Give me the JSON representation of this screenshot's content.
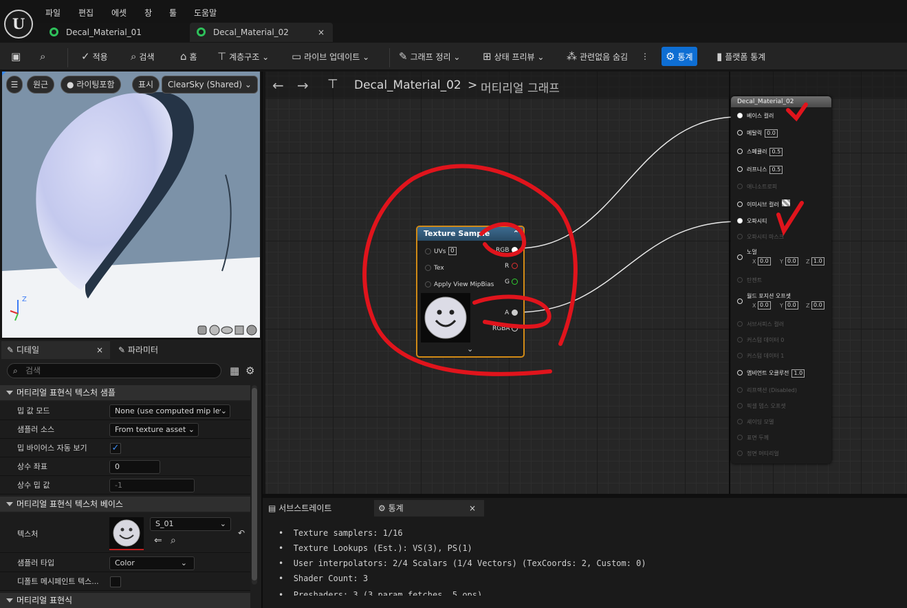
{
  "menu": {
    "file": "파일",
    "edit": "편집",
    "asset": "에셋",
    "window": "창",
    "tools": "툴",
    "help": "도움말"
  },
  "tabs": [
    {
      "label": "Decal_Material_01"
    },
    {
      "label": "Decal_Material_02",
      "close": "×"
    }
  ],
  "toolbar": {
    "apply": "적용",
    "search": "검색",
    "home": "홈",
    "hierarchy": "계층구조",
    "live_update": "라이브 업데이트",
    "clean_graph": "그래프 정리",
    "state_preview": "상태 프리뷰",
    "hide_unrelated": "관련없음 숨김",
    "stats": "통계",
    "platform_stats": "플랫폼 통계"
  },
  "viewport": {
    "perspective": "원근",
    "lighting": "라이팅포함",
    "show": "표시",
    "sky": "ClearSky (Shared)",
    "axis_z": "Z"
  },
  "details": {
    "tab_details": "디테일",
    "tab_params": "파라미터",
    "tab_close": "×",
    "search_placeholder": "검색",
    "section_sample": "머티리얼 표현식 텍스처 샘플",
    "mip_mode_label": "밉 값 모드",
    "mip_mode_value": "None (use computed mip lev",
    "sampler_source_label": "샘플러 소스",
    "sampler_source_value": "From texture asset",
    "mip_bias_label": "밉 바이어스 자동 보기",
    "mip_bias_check": "✓",
    "const_coord_label": "상수 좌표",
    "const_coord_value": "0",
    "const_mip_label": "상수 밉 값",
    "const_mip_value": "-1",
    "section_base": "머티리얼 표현식 텍스처 베이스",
    "texture_label": "텍스처",
    "texture_value": "S_01",
    "sampler_type_label": "샘플러 타입",
    "sampler_type_value": "Color",
    "default_mesh_label": "디폴트 메시페인트 텍스...",
    "section_expr": "머티리얼 표현식"
  },
  "graph": {
    "asset": "Decal_Material_02",
    "separator": ">",
    "graph_name": "머티리얼 그래프"
  },
  "texture_node": {
    "title": "Texture Sample",
    "uvs": "UVs",
    "uvs_value": "0",
    "tex": "Tex",
    "apply_mip": "Apply View MipBias",
    "rgb": "RGB",
    "r": "R",
    "g": "G",
    "a": "A",
    "rgba": "RGBA"
  },
  "result_node": {
    "title": "Decal_Material_02",
    "pins": [
      {
        "label": "베이스 컬러",
        "active": true,
        "connected": true
      },
      {
        "label": "메탈릭",
        "active": true,
        "value": "0.0"
      },
      {
        "label": "스페큘러",
        "active": true,
        "value": "0.5"
      },
      {
        "label": "러프니스",
        "active": true,
        "value": "0.5"
      },
      {
        "label": "애니소트로피",
        "active": false
      },
      {
        "label": "이미시브 컬러",
        "active": true
      },
      {
        "label": "오파시티",
        "active": true,
        "connected": true
      },
      {
        "label": "오파시티 마스크",
        "active": false
      },
      {
        "label": "노멀",
        "active": true,
        "x": "0.0",
        "y": "0.0",
        "z": "1.0"
      },
      {
        "label": "탄젠트",
        "active": false
      },
      {
        "label": "월드 포지션 오프셋",
        "active": true,
        "x": "0.0",
        "y": "0.0",
        "z": "0.0"
      },
      {
        "label": "서브서피스 컬러",
        "active": false
      },
      {
        "label": "커스텀 데이터 0",
        "active": false
      },
      {
        "label": "커스텀 데이터 1",
        "active": false
      },
      {
        "label": "앰비언트 오클루전",
        "active": true,
        "value": "1.0"
      },
      {
        "label": "리프랙션 (Disabled)",
        "active": false
      },
      {
        "label": "픽셀 뎁스 오프셋",
        "active": false
      },
      {
        "label": "셰이딩 모델",
        "active": false
      },
      {
        "label": "표면 두께",
        "active": false
      },
      {
        "label": "정면 머티리얼",
        "active": false
      }
    ]
  },
  "bottom": {
    "tab_substrate": "서브스트레이트",
    "tab_stats": "통계",
    "tab_close": "×",
    "lines": [
      "Texture samplers: 1/16",
      "Texture Lookups (Est.): VS(3), PS(1)",
      "User interpolators: 2/4 Scalars (1/4 Vectors) (TexCoords: 2, Custom: 0)",
      "Shader Count: 3",
      "Preshaders: 3  (3 param fetches, 5 ops)"
    ]
  },
  "colors": {
    "accent": "#0e6ed3",
    "annotation": "#e0141c",
    "node_border": "#d18a16"
  }
}
